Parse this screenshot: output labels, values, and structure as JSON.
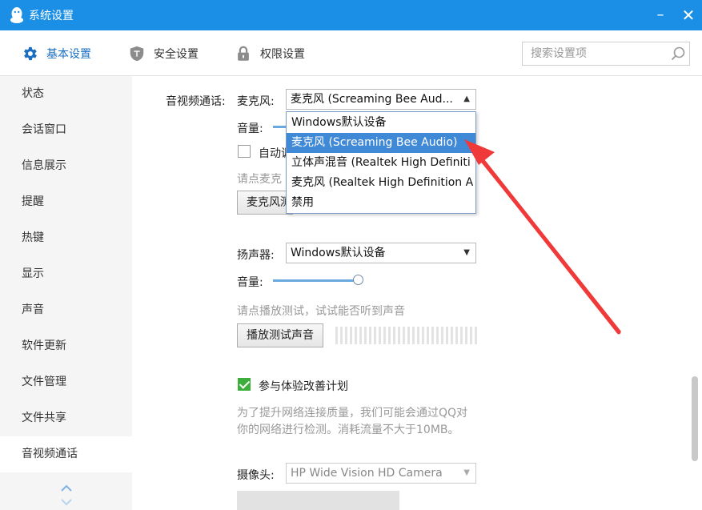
{
  "window": {
    "title": "系统设置",
    "minimize_symbol": "–",
    "close_symbol": "✕"
  },
  "toolbar": {
    "tabs": [
      {
        "label": "基本设置",
        "icon": "gear-icon"
      },
      {
        "label": "安全设置",
        "icon": "shield-icon"
      },
      {
        "label": "权限设置",
        "icon": "lock-icon"
      }
    ],
    "search_placeholder": "搜索设置项"
  },
  "sidebar": {
    "items": [
      {
        "label": "状态"
      },
      {
        "label": "会话窗口"
      },
      {
        "label": "信息展示"
      },
      {
        "label": "提醒"
      },
      {
        "label": "热键"
      },
      {
        "label": "显示"
      },
      {
        "label": "声音"
      },
      {
        "label": "软件更新"
      },
      {
        "label": "文件管理"
      },
      {
        "label": "文件共享"
      },
      {
        "label": "音视频通话"
      }
    ],
    "active_index": 10
  },
  "av": {
    "section_label": "音视频通话:",
    "mic": {
      "label": "麦克风:",
      "selected": "麦克风 (Screaming Bee Aud...",
      "volume_label": "音量:",
      "auto_adjust_label": "自动调",
      "hint": "请点麦克",
      "test_button": "麦克风测",
      "options": [
        "Windows默认设备",
        "麦克风 (Screaming Bee Audio)",
        "立体声混音 (Realtek High Definiti",
        "麦克风 (Realtek High Definition A",
        "禁用"
      ],
      "highlighted_index": 1
    },
    "speaker": {
      "label": "扬声器:",
      "selected": "Windows默认设备",
      "volume_label": "音量:",
      "volume_percent": 100,
      "hint": "请点播放测试，试试能否听到声音",
      "test_button": "播放测试声音"
    },
    "experience": {
      "label": "参与体验改善计划",
      "checked": true,
      "desc_line1": "为了提升网络连接质量，我们可能会通过QQ对",
      "desc_line2": "你的网络进行检测。消耗流量不大于10MB。"
    },
    "camera": {
      "label": "摄像头:",
      "selected": "HP Wide Vision HD Camera"
    }
  },
  "colors": {
    "titlebar": "#1a8fe5",
    "accent": "#1a6fc2",
    "selected_option": "#3f89d6",
    "annotation_arrow": "#f03a3a",
    "check_green": "#3bae3b"
  }
}
